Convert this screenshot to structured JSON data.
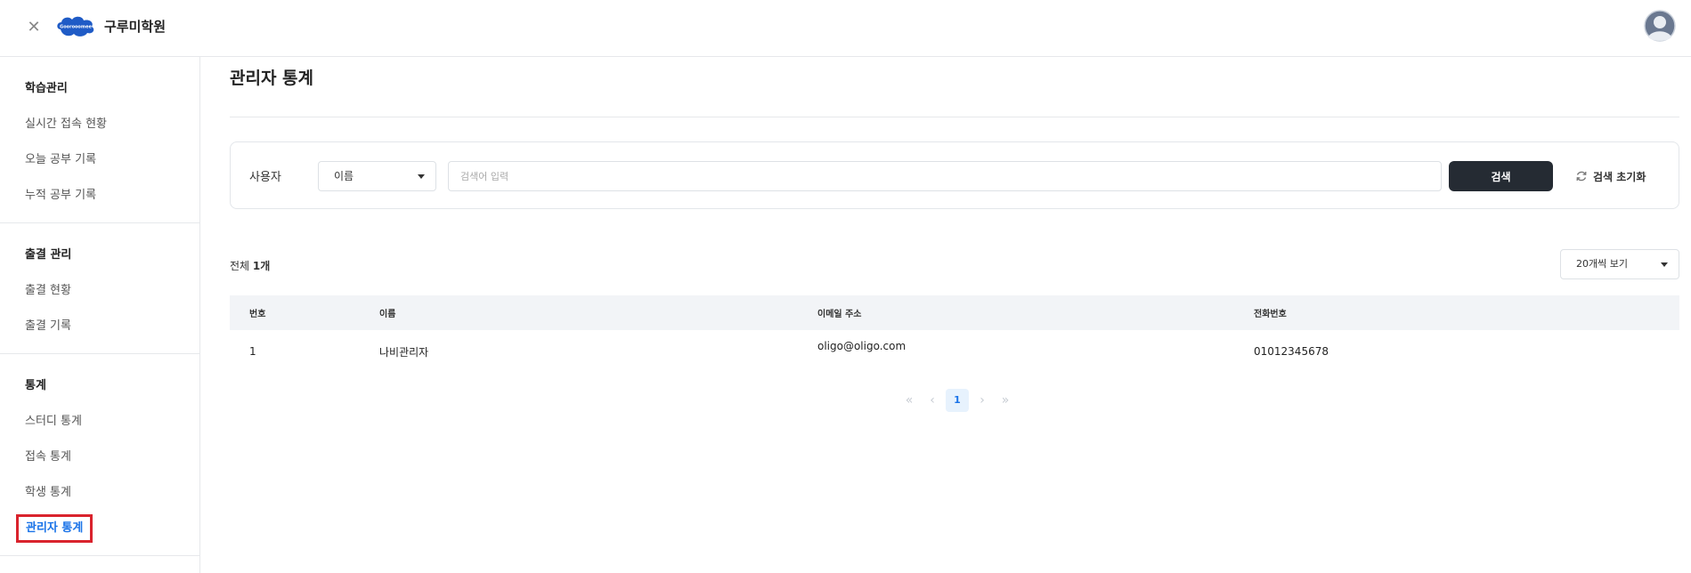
{
  "header": {
    "logo_text": "Goorooomee",
    "brand_name": "구루미학원"
  },
  "sidebar": {
    "groups": [
      {
        "title": "학습관리",
        "items": [
          "실시간 접속 현황",
          "오늘 공부 기록",
          "누적 공부 기록"
        ]
      },
      {
        "title": "출결 관리",
        "items": [
          "출결 현황",
          "출결 기록"
        ]
      },
      {
        "title": "통계",
        "items": [
          "스터디 통계",
          "접속 통계",
          "학생 통계",
          "관리자 통계"
        ]
      }
    ],
    "active_item": "관리자 통계"
  },
  "main": {
    "page_title": "관리자 통계",
    "search": {
      "label": "사용자",
      "select_value": "이름",
      "placeholder": "검색어 입력",
      "search_button": "검색",
      "reset_button": "검색 초기화"
    },
    "total_prefix": "전체 ",
    "total_count": "1개",
    "per_page": "20개씩 보기",
    "table": {
      "headers": [
        "번호",
        "이름",
        "이메일 주소",
        "전화번호"
      ],
      "rows": [
        [
          "1",
          "나비관리자",
          "oligo@oligo.com",
          "01012345678"
        ]
      ]
    },
    "pagination": {
      "current_page": "1",
      "first": "«",
      "prev": "‹",
      "next": "›",
      "last": "»"
    }
  },
  "colors": {
    "accent": "#1a73e8",
    "dark_button": "#252b33",
    "highlight_box": "#d9232d"
  }
}
